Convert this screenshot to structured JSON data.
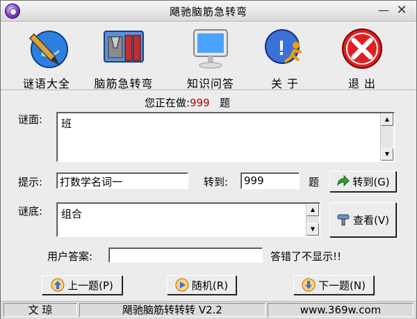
{
  "title": "飓驰脑筋急转弯",
  "titlebar": {
    "minimize": "—",
    "close": "✕"
  },
  "toolbar": {
    "items": [
      {
        "label": "谜语大全",
        "icon": "pen-globe-icon"
      },
      {
        "label": "脑筋急转弯",
        "icon": "toolbox-icon"
      },
      {
        "label": "知识问答",
        "icon": "monitor-icon"
      },
      {
        "label": "关 于",
        "icon": "info-runner-icon"
      },
      {
        "label": "退 出",
        "icon": "exit-x-icon"
      }
    ]
  },
  "progress": {
    "prefix": "您正在做:",
    "number": "999",
    "suffix": "题"
  },
  "riddle": {
    "label": "谜面:",
    "text": "班"
  },
  "hint": {
    "label": "提示:",
    "value": "打数学名词一"
  },
  "goto": {
    "label": "转到:",
    "value": "999",
    "suffix": "题",
    "button": "转到(G)"
  },
  "answer": {
    "label": "谜底:",
    "text": "组合",
    "button": "查看(V)"
  },
  "user_answer": {
    "label": "用户答案:",
    "value": "",
    "note": "答错了不显示!!"
  },
  "nav": {
    "prev": "上一题(P)",
    "random": "随机(R)",
    "next": "下一题(N)"
  },
  "status": {
    "left": "文 琼",
    "center": "飓驰脑筋转转转 V2.2",
    "right": "www.369w.com"
  }
}
